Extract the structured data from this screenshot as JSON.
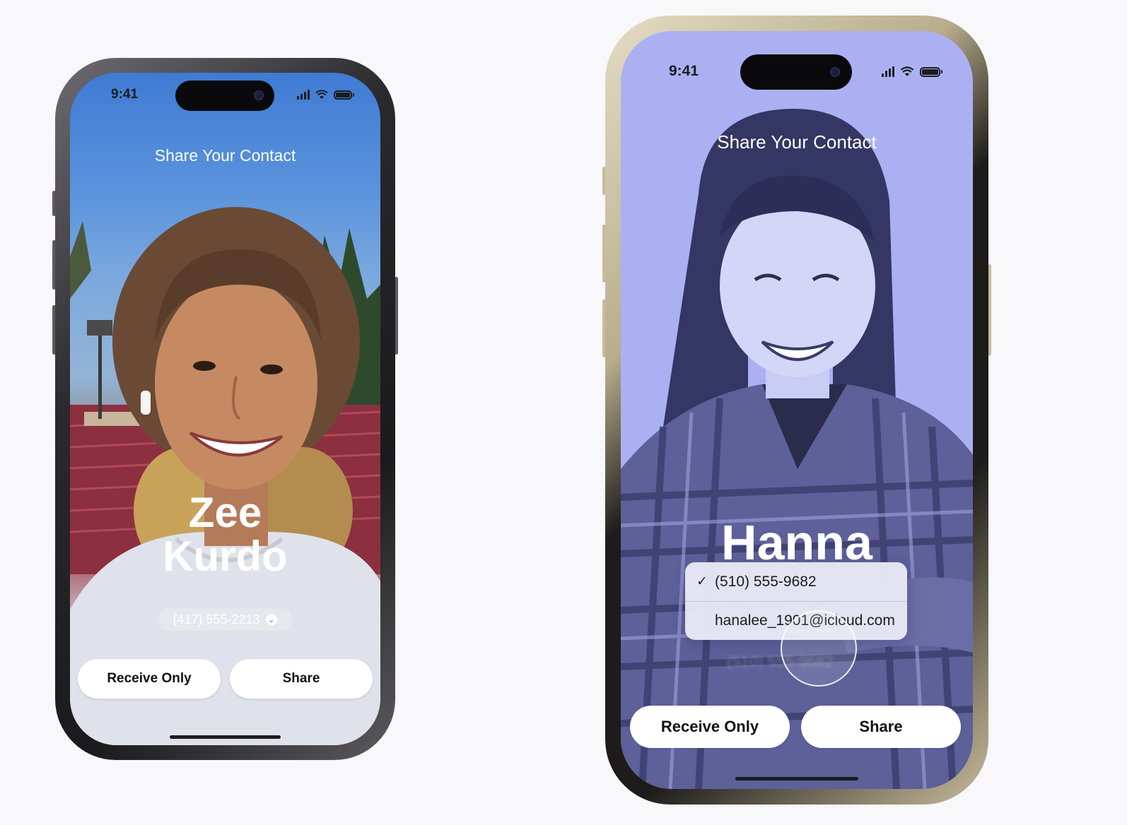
{
  "phones": [
    {
      "status": {
        "time": "9:41"
      },
      "title": "Share Your Contact",
      "contact": {
        "first_name": "Zee",
        "last_name": "Kurdo",
        "phone": "(417) 555-2213"
      },
      "buttons": {
        "receive": "Receive Only",
        "share": "Share"
      },
      "accent_color": "#3f7bd4"
    },
    {
      "status": {
        "time": "9:41"
      },
      "title": "Share Your Contact",
      "contact": {
        "first_name": "Hanna"
      },
      "menu": [
        {
          "label": "(510) 555-9682",
          "checked": true
        },
        {
          "label": "hanalee_1901@icloud.com",
          "checked": false
        }
      ],
      "buttons": {
        "receive": "Receive Only",
        "share": "Share"
      },
      "accent_color": "#aab0f2"
    }
  ]
}
